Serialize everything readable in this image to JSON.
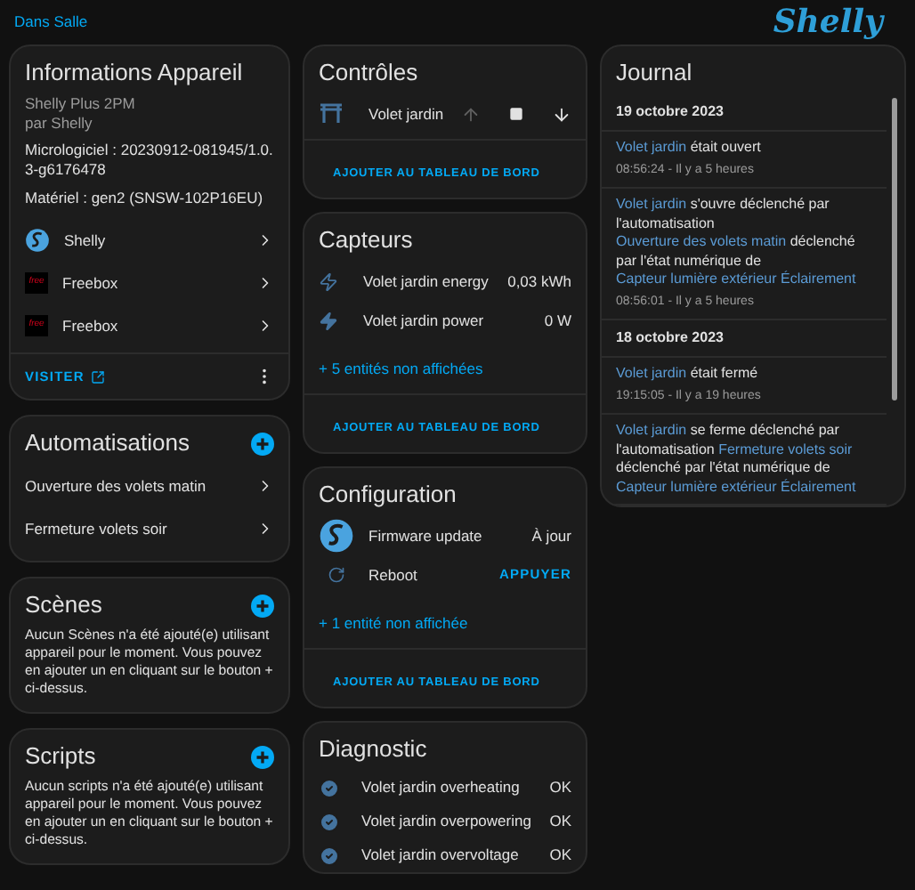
{
  "header": {
    "breadcrumb": "Dans Salle",
    "logo": "Shelly"
  },
  "device_info": {
    "title": "Informations Appareil",
    "model": "Shelly Plus 2PM",
    "maker": "par Shelly",
    "firmware": "Micrologiciel : 20230912-081945/1.0.3-g6176478",
    "hardware": "Matériel : gen2 (SNSW-102P16EU)",
    "integrations": [
      {
        "kind": "shelly",
        "label": "Shelly"
      },
      {
        "kind": "freebox",
        "label": "Freebox",
        "logo_text": "free"
      },
      {
        "kind": "freebox",
        "label": "Freebox",
        "logo_text": "free"
      }
    ],
    "visit_button": "VISITER"
  },
  "automations": {
    "title": "Automatisations",
    "items": [
      "Ouverture des volets matin",
      "Fermeture volets soir"
    ]
  },
  "scenes": {
    "title": "Scènes",
    "message": "Aucun Scènes n'a été ajouté(e) utilisant appareil pour le moment. Vous pouvez en ajouter un en cliquant sur le bouton + ci-dessus."
  },
  "scripts": {
    "title": "Scripts",
    "message": "Aucun scripts n'a été ajouté(e) utilisant appareil pour le moment. Vous pouvez en ajouter un en cliquant sur le bouton + ci-dessus."
  },
  "controls": {
    "title": "Contrôles",
    "entities": [
      {
        "name": "Volet jardin",
        "up_disabled": true,
        "stop_disabled": false,
        "down_disabled": false
      }
    ],
    "add_button": "AJOUTER AU TABLEAU DE BORD"
  },
  "sensors": {
    "title": "Capteurs",
    "entities": [
      {
        "kind": "energy",
        "name": "Volet jardin energy",
        "value": "0,03 kWh"
      },
      {
        "kind": "power",
        "name": "Volet jardin power",
        "value": "0 W"
      }
    ],
    "more": "+ 5 entités non affichées",
    "add_button": "AJOUTER AU TABLEAU DE BORD"
  },
  "configuration": {
    "title": "Configuration",
    "entities": [
      {
        "kind": "firmware",
        "name": "Firmware update",
        "value": "À jour"
      },
      {
        "kind": "button",
        "name": "Reboot",
        "value": "APPUYER"
      }
    ],
    "more": "+ 1 entité non affichée",
    "add_button": "AJOUTER AU TABLEAU DE BORD"
  },
  "diagnostic": {
    "title": "Diagnostic",
    "entities": [
      {
        "name": "Volet jardin overheating",
        "value": "OK"
      },
      {
        "name": "Volet jardin overpowering",
        "value": "OK"
      },
      {
        "name": "Volet jardin overvoltage",
        "value": "OK"
      }
    ]
  },
  "journal": {
    "title": "Journal",
    "days": [
      {
        "date": "19 octobre 2023",
        "entries": [
          {
            "parts": [
              {
                "text": "Volet jardin",
                "link": true
              },
              {
                "text": " était ouvert",
                "link": false
              }
            ],
            "time": "08:56:24 - Il y a 5 heures"
          },
          {
            "parts": [
              {
                "text": "Volet jardin",
                "link": true
              },
              {
                "text": " s'ouvre déclenché par l'automatisation ",
                "link": false
              },
              {
                "text": "Ouverture des volets matin",
                "link": true
              },
              {
                "text": " déclenché par l'état numérique de ",
                "link": false
              },
              {
                "text": "Capteur lumière extérieur Éclairement",
                "link": true
              }
            ],
            "time": "08:56:01 - Il y a 5 heures"
          }
        ]
      },
      {
        "date": "18 octobre 2023",
        "entries": [
          {
            "parts": [
              {
                "text": "Volet jardin",
                "link": true
              },
              {
                "text": " était fermé",
                "link": false
              }
            ],
            "time": "19:15:05 - Il y a 19 heures"
          },
          {
            "parts": [
              {
                "text": "Volet jardin",
                "link": true
              },
              {
                "text": " se ferme déclenché par l'automatisation ",
                "link": false
              },
              {
                "text": "Fermeture volets soir",
                "link": true
              },
              {
                "text": " déclenché par l'état numérique de ",
                "link": false
              },
              {
                "text": "Capteur lumière extérieur Éclairement",
                "link": true
              }
            ]
          }
        ]
      }
    ]
  }
}
